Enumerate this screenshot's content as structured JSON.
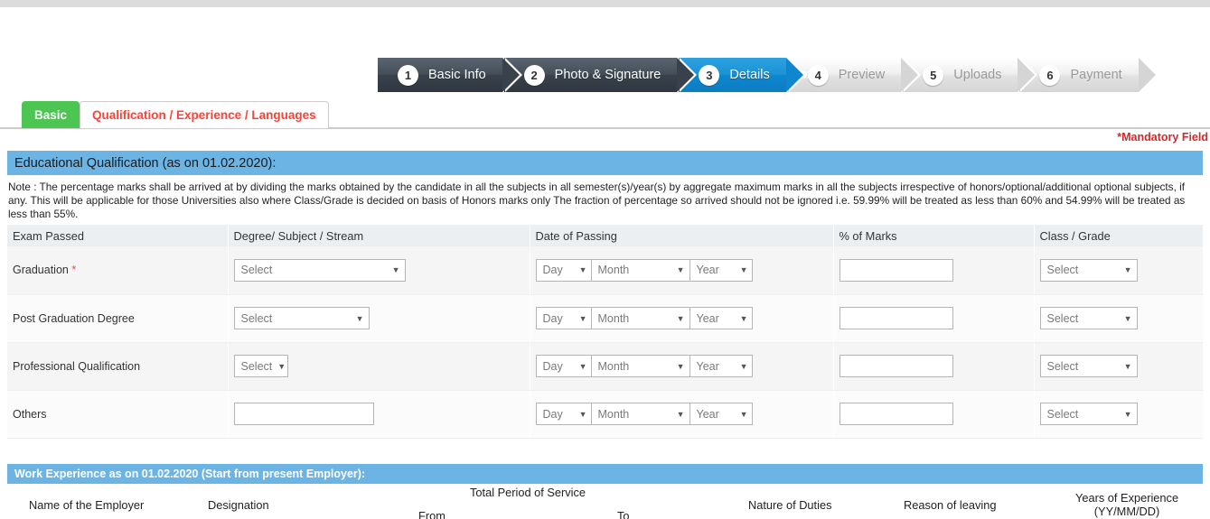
{
  "wizard": {
    "steps": [
      {
        "num": "1",
        "label": "Basic Info",
        "state": "done"
      },
      {
        "num": "2",
        "label": "Photo & Signature",
        "state": "done"
      },
      {
        "num": "3",
        "label": "Details",
        "state": "active"
      },
      {
        "num": "4",
        "label": "Preview",
        "state": "todo"
      },
      {
        "num": "5",
        "label": "Uploads",
        "state": "todo"
      },
      {
        "num": "6",
        "label": "Payment",
        "state": "todo"
      }
    ],
    "progress_chevrons": "»"
  },
  "tabs": [
    {
      "label": "Basic",
      "active": true
    },
    {
      "label": "Qualification / Experience / Languages",
      "active": false
    }
  ],
  "mandatory_note": "*Mandatory Field",
  "education": {
    "section_title": "Educational Qualification (as on 01.02.2020):",
    "note": "Note : The percentage marks shall be arrived at by dividing the marks obtained by the candidate in all the subjects in all semester(s)/year(s) by aggregate maximum marks in all the subjects irrespective of honors/optional/additional optional subjects, if any. This will be applicable for those Universities also where Class/Grade is decided on basis of Honors marks only The fraction of percentage so arrived should not be ignored i.e. 59.99% will be treated as less than 60% and 54.99% will be treated as less than 55%.",
    "columns": [
      "Exam Passed",
      "Degree/ Subject / Stream",
      "Date of Passing",
      "% of Marks",
      "Class / Grade"
    ],
    "select_placeholder": "Select",
    "day_placeholder": "Day",
    "month_placeholder": "Month",
    "year_placeholder": "Year",
    "rows": [
      {
        "exam": "Graduation",
        "required": true,
        "degree_control": "select-wide",
        "marks": "",
        "grade": "Select"
      },
      {
        "exam": "Post Graduation Degree",
        "required": false,
        "degree_control": "select-mid",
        "marks": "",
        "grade": "Select"
      },
      {
        "exam": "Professional Qualification",
        "required": false,
        "degree_control": "select-small",
        "marks": "",
        "grade": "Select"
      },
      {
        "exam": "Others",
        "required": false,
        "degree_control": "text",
        "marks": "",
        "grade": "Select"
      }
    ]
  },
  "work": {
    "section_title": "Work Experience as on 01.02.2020 (Start from present Employer):",
    "columns": {
      "employer": "Name of the Employer",
      "designation": "Designation",
      "total_period": "Total Period of Service",
      "from": "From",
      "to": "To",
      "nature": "Nature of Duties",
      "reason": "Reason of leaving",
      "years": "Years of Experience",
      "years_format": "(YY/MM/DD)"
    }
  },
  "colors": {
    "section_blue": "#6cb4e4",
    "tab_green": "#4cc552",
    "tab_red": "#ff4136",
    "active_step_blue": "#0f86cd",
    "mandatory_red": "#d12a2a"
  }
}
